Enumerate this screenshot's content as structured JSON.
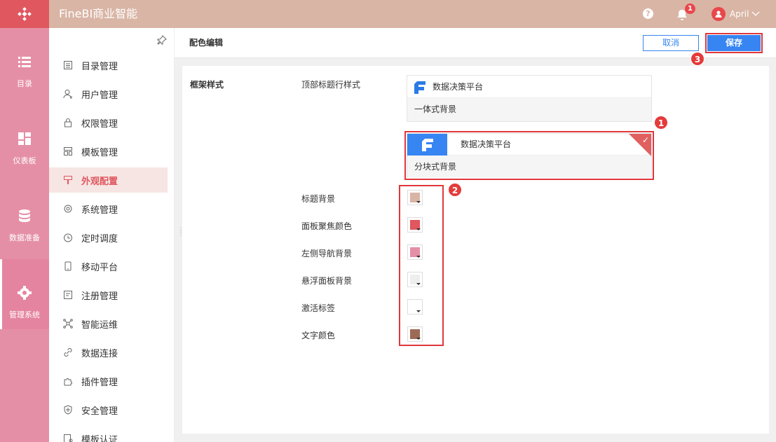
{
  "app": {
    "title": "FineBI商业智能"
  },
  "topbar": {
    "notification_count": "1",
    "user_name": "April"
  },
  "rail": [
    {
      "label": "目录",
      "icon": "list-icon"
    },
    {
      "label": "仪表板",
      "icon": "dashboard-grid-icon"
    },
    {
      "label": "数据准备",
      "icon": "database-icon"
    },
    {
      "label": "管理系统",
      "icon": "gear-icon"
    }
  ],
  "menu": [
    {
      "label": "目录管理",
      "icon": "catalog-icon"
    },
    {
      "label": "用户管理",
      "icon": "user-icon"
    },
    {
      "label": "权限管理",
      "icon": "lock-icon"
    },
    {
      "label": "模板管理",
      "icon": "template-icon"
    },
    {
      "label": "外观配置",
      "icon": "brush-icon"
    },
    {
      "label": "系统管理",
      "icon": "settings-icon"
    },
    {
      "label": "定时调度",
      "icon": "clock-icon"
    },
    {
      "label": "移动平台",
      "icon": "mobile-icon"
    },
    {
      "label": "注册管理",
      "icon": "register-icon"
    },
    {
      "label": "智能运维",
      "icon": "network-icon"
    },
    {
      "label": "数据连接",
      "icon": "link-icon"
    },
    {
      "label": "插件管理",
      "icon": "plugin-icon"
    },
    {
      "label": "安全管理",
      "icon": "shield-icon"
    },
    {
      "label": "模板认证",
      "icon": "cert-icon"
    }
  ],
  "header": {
    "title": "配色编辑",
    "cancel": "取消",
    "save": "保存"
  },
  "form": {
    "section": "框架样式",
    "top_title_style_label": "顶部标题行样式",
    "card1": {
      "brand": "数据决策平台",
      "caption": "一体式背景"
    },
    "card2": {
      "brand": "数据决策平台",
      "caption": "分块式背景"
    },
    "colors": [
      {
        "label": "标题背景",
        "value": "#d9b5a5"
      },
      {
        "label": "面板聚焦颜色",
        "value": "#e0575f"
      },
      {
        "label": "左侧导航背景",
        "value": "#e58fa6"
      },
      {
        "label": "悬浮面板背景",
        "value": "#eeeeee"
      },
      {
        "label": "激活标签",
        "value": "#ffffff"
      },
      {
        "label": "文字颜色",
        "value": "#9c6b56"
      }
    ]
  },
  "callouts": [
    "1",
    "2",
    "3"
  ]
}
